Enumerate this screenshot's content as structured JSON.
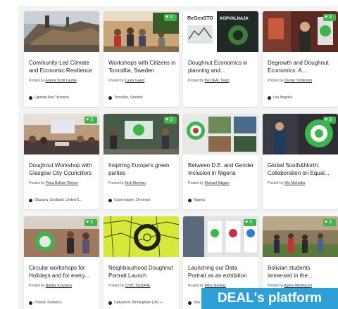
{
  "cards": [
    {
      "title": "Community-Led Climate and Economic Resilience",
      "poster_prefix": "Posted by",
      "poster": "Anesia Scott Laudie",
      "location": "Uganda And Tanzania",
      "likes": ""
    },
    {
      "title": "Workshops with Citizens in Tornoillia, Sweden",
      "poster_prefix": "Posted by",
      "poster": "Laura Guest",
      "location": "Tornoillia, Sweden",
      "likes": "3"
    },
    {
      "title": "Doughnut Economics in planning and...",
      "poster_prefix": "Posted by",
      "poster": "the DEAL Team",
      "location": "",
      "likes": ""
    },
    {
      "title": "Degrowth and Doughnut Economics: A...",
      "poster_prefix": "Posted by",
      "poster": "Declan Tomlinson",
      "location": "Los Angeles",
      "likes": "3"
    },
    {
      "title": "Doughnut Workshop with Glasgow City Councillors",
      "poster_prefix": "Posted by",
      "poster": "Petra Balkan Olehno",
      "location": "Glasgow, Scotland, United K...",
      "likes": "3"
    },
    {
      "title": "Inspiring Europe's green parties",
      "poster_prefix": "Posted by",
      "poster": "Nick Mermen",
      "location": "Copenhagen, Denmark",
      "likes": "3"
    },
    {
      "title": "Between D.E. and Gender Inclusion in Nigeria",
      "poster_prefix": "Posted by",
      "poster": "Michael Adigam",
      "location": "Nigeria",
      "likes": ""
    },
    {
      "title": "Global South&North: Collaboration on Equal...",
      "poster_prefix": "Posted by",
      "poster": "Nils Michalka",
      "location": "",
      "likes": "3"
    },
    {
      "title": "Circular workshops for Holidays and for every...",
      "poster_prefix": "Posted by",
      "poster": "Natalia Kurygera",
      "location": "Poland, Katowice",
      "likes": "3"
    },
    {
      "title": "Neighbourhood Doughnut Portrait Launch",
      "poster_prefix": "Posted by",
      "poster": "CIVIC SQUARE",
      "location": "Ladywood, Birmingham (UK) +...",
      "likes": ""
    },
    {
      "title": "Launching our Data Portrait as an exhibition",
      "poster_prefix": "Posted by",
      "poster": "Miha Slamiau",
      "location": "Sha...",
      "likes": "3"
    },
    {
      "title": "Bolivian students immersed in the...",
      "poster_prefix": "Posted by",
      "poster": "Agnes Medinaceli",
      "location": "",
      "likes": "3"
    }
  ],
  "thumb_texts": {
    "card3_logo": "ReGenSTO",
    "card3_sub": "KOPVALNAJA"
  },
  "badge": "DEAL's platform",
  "colors": {
    "like_green": "#3cb64a",
    "badge_blue": "#2f9fd7"
  }
}
